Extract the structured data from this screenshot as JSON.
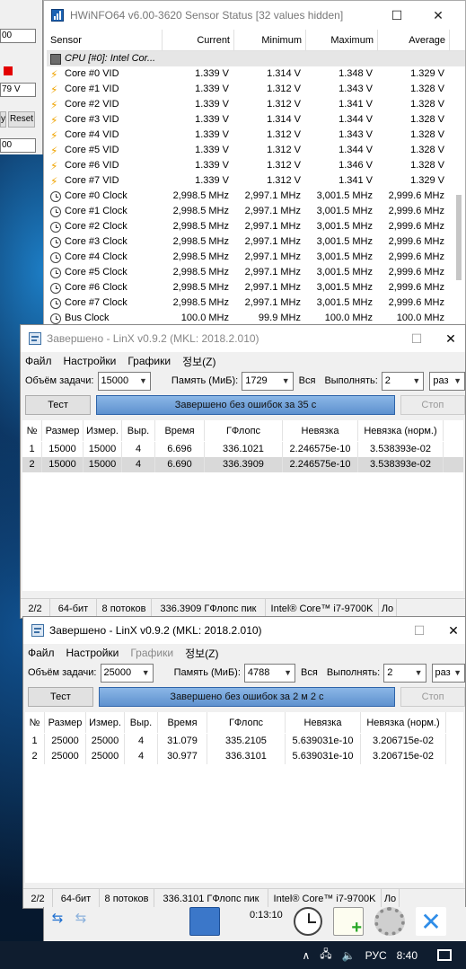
{
  "behind_window": {
    "field1": "00",
    "field2": "79 V",
    "field3": "00",
    "btn_left": "y",
    "btn_reset": "Reset"
  },
  "hwinfo": {
    "title": "HWiNFO64 v6.00-3620 Sensor Status [32 values hidden]",
    "columns": [
      "Sensor",
      "Current",
      "Minimum",
      "Maximum",
      "Average"
    ],
    "group": "CPU [#0]: Intel Cor...",
    "rows": [
      {
        "icon": "bolt",
        "name": "Core #0 VID",
        "cur": "1.339 V",
        "min": "1.314 V",
        "max": "1.348 V",
        "avg": "1.329 V"
      },
      {
        "icon": "bolt",
        "name": "Core #1 VID",
        "cur": "1.339 V",
        "min": "1.312 V",
        "max": "1.343 V",
        "avg": "1.328 V"
      },
      {
        "icon": "bolt",
        "name": "Core #2 VID",
        "cur": "1.339 V",
        "min": "1.312 V",
        "max": "1.341 V",
        "avg": "1.328 V"
      },
      {
        "icon": "bolt",
        "name": "Core #3 VID",
        "cur": "1.339 V",
        "min": "1.314 V",
        "max": "1.344 V",
        "avg": "1.328 V"
      },
      {
        "icon": "bolt",
        "name": "Core #4 VID",
        "cur": "1.339 V",
        "min": "1.312 V",
        "max": "1.343 V",
        "avg": "1.328 V"
      },
      {
        "icon": "bolt",
        "name": "Core #5 VID",
        "cur": "1.339 V",
        "min": "1.312 V",
        "max": "1.344 V",
        "avg": "1.328 V"
      },
      {
        "icon": "bolt",
        "name": "Core #6 VID",
        "cur": "1.339 V",
        "min": "1.312 V",
        "max": "1.346 V",
        "avg": "1.328 V"
      },
      {
        "icon": "bolt",
        "name": "Core #7 VID",
        "cur": "1.339 V",
        "min": "1.312 V",
        "max": "1.341 V",
        "avg": "1.329 V"
      },
      {
        "icon": "clock",
        "name": "Core #0 Clock",
        "cur": "2,998.5 MHz",
        "min": "2,997.1 MHz",
        "max": "3,001.5 MHz",
        "avg": "2,999.6 MHz"
      },
      {
        "icon": "clock",
        "name": "Core #1 Clock",
        "cur": "2,998.5 MHz",
        "min": "2,997.1 MHz",
        "max": "3,001.5 MHz",
        "avg": "2,999.6 MHz"
      },
      {
        "icon": "clock",
        "name": "Core #2 Clock",
        "cur": "2,998.5 MHz",
        "min": "2,997.1 MHz",
        "max": "3,001.5 MHz",
        "avg": "2,999.6 MHz"
      },
      {
        "icon": "clock",
        "name": "Core #3 Clock",
        "cur": "2,998.5 MHz",
        "min": "2,997.1 MHz",
        "max": "3,001.5 MHz",
        "avg": "2,999.6 MHz"
      },
      {
        "icon": "clock",
        "name": "Core #4 Clock",
        "cur": "2,998.5 MHz",
        "min": "2,997.1 MHz",
        "max": "3,001.5 MHz",
        "avg": "2,999.6 MHz"
      },
      {
        "icon": "clock",
        "name": "Core #5 Clock",
        "cur": "2,998.5 MHz",
        "min": "2,997.1 MHz",
        "max": "3,001.5 MHz",
        "avg": "2,999.6 MHz"
      },
      {
        "icon": "clock",
        "name": "Core #6 Clock",
        "cur": "2,998.5 MHz",
        "min": "2,997.1 MHz",
        "max": "3,001.5 MHz",
        "avg": "2,999.6 MHz"
      },
      {
        "icon": "clock",
        "name": "Core #7 Clock",
        "cur": "2,998.5 MHz",
        "min": "2,997.1 MHz",
        "max": "3,001.5 MHz",
        "avg": "2,999.6 MHz"
      },
      {
        "icon": "clock",
        "name": "Bus Clock",
        "cur": "100.0 MHz",
        "min": "99.9 MHz",
        "max": "100.0 MHz",
        "avg": "100.0 MHz"
      }
    ]
  },
  "linx1": {
    "title": "Завершено - LinX v0.9.2 (MKL: 2018.2.010)",
    "menu": [
      "Файл",
      "Настройки",
      "Графики",
      "정보(Z)"
    ],
    "size_label": "Объём задачи:",
    "size_value": "15000",
    "memory_label": "Память (МиБ):",
    "memory_value": "1729",
    "all_label": "Вся",
    "run_label": "Выполнять:",
    "run_value": "2",
    "times_value": "раз",
    "test_button": "Тест",
    "progress_text": "Завершено без ошибок за 35 с",
    "progress": 1.0,
    "stop_button": "Стоп",
    "columns": [
      "№",
      "Размер",
      "Измер.",
      "Выр.",
      "Время",
      "ГФлопс",
      "Невязка",
      "Невязка (норм.)"
    ],
    "rows": [
      [
        "1",
        "15000",
        "15000",
        "4",
        "6.696",
        "336.1021",
        "2.246575e-10",
        "3.538393e-02"
      ],
      [
        "2",
        "15000",
        "15000",
        "4",
        "6.690",
        "336.3909",
        "2.246575e-10",
        "3.538393e-02"
      ]
    ],
    "status": [
      "2/2",
      "64-бит",
      "8 потоков",
      "336.3909 ГФлопс пик",
      "Intel® Core™ i7-9700K",
      "Ло"
    ]
  },
  "linx2": {
    "title": "Завершено - LinX v0.9.2 (MKL: 2018.2.010)",
    "menu": [
      "Файл",
      "Настройки",
      "Графики",
      "정보(Z)"
    ],
    "size_label": "Объём задачи:",
    "size_value": "25000",
    "memory_label": "Память (МиБ):",
    "memory_value": "4788",
    "all_label": "Вся",
    "run_label": "Выполнять:",
    "run_value": "2",
    "times_value": "раз",
    "test_button": "Тест",
    "progress_text": "Завершено без ошибок за 2 м 2 с",
    "progress": 1.0,
    "stop_button": "Стоп",
    "columns": [
      "№",
      "Размер",
      "Измер.",
      "Выр.",
      "Время",
      "ГФлопс",
      "Невязка",
      "Невязка (норм.)"
    ],
    "rows": [
      [
        "1",
        "25000",
        "25000",
        "4",
        "31.079",
        "335.2105",
        "5.639031e-10",
        "3.206715e-02"
      ],
      [
        "2",
        "25000",
        "25000",
        "4",
        "30.977",
        "336.3101",
        "5.639031e-10",
        "3.206715e-02"
      ]
    ],
    "status": [
      "2/2",
      "64-бит",
      "8 потоков",
      "336.3101 ГФлопс пик",
      "Intel® Core™ i7-9700K",
      "Ло"
    ]
  },
  "hw_toolbar": {
    "timer": "0:13:10"
  },
  "taskbar": {
    "language": "РУС",
    "time": "8:40",
    "tray_icons": [
      "chevron-up-icon",
      "network-icon",
      "volume-icon"
    ]
  }
}
